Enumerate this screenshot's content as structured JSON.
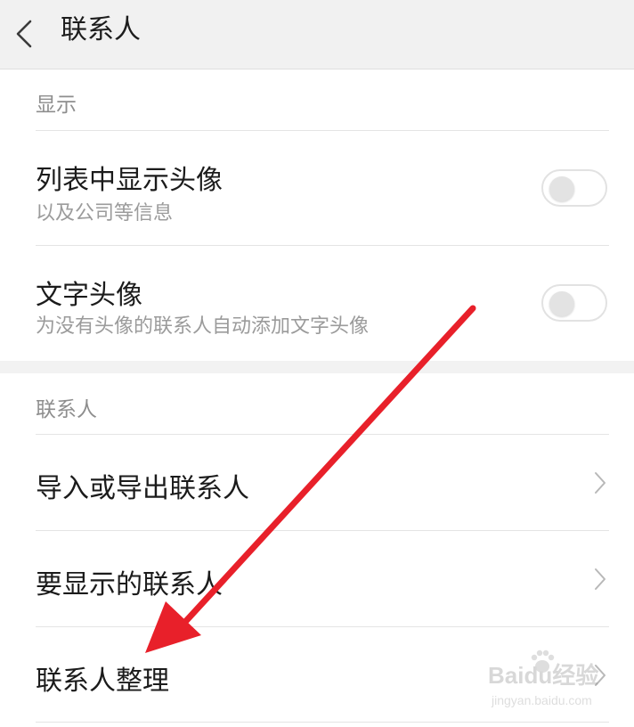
{
  "header": {
    "title": "联系人",
    "back_icon": "chevron-left-icon"
  },
  "sections": [
    {
      "header": "显示",
      "rows": [
        {
          "title": "列表中显示头像",
          "subtitle": "以及公司等信息",
          "control": "toggle",
          "enabled": false
        },
        {
          "title": "文字头像",
          "subtitle": "为没有头像的联系人自动添加文字头像",
          "control": "toggle",
          "enabled": false
        }
      ]
    },
    {
      "header": "联系人",
      "rows": [
        {
          "title": "导入或导出联系人",
          "control": "chevron-right-icon"
        },
        {
          "title": "要显示的联系人",
          "control": "chevron-right-icon"
        },
        {
          "title": "联系人整理",
          "control": "chevron-right-icon"
        }
      ]
    }
  ],
  "annotation": {
    "type": "arrow",
    "color": "#e8202a"
  },
  "watermark": {
    "text": "Baidu经验",
    "url": "jingyan.baidu.com"
  }
}
